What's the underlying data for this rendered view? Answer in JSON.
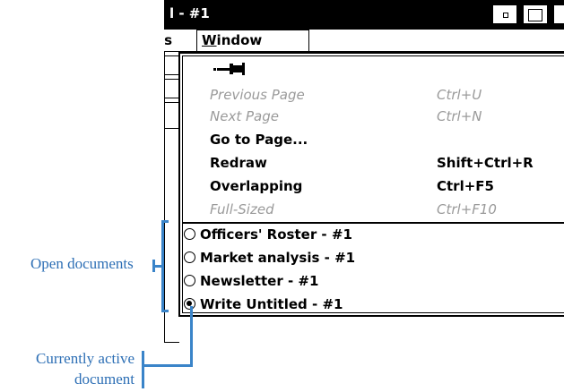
{
  "window": {
    "title": "l - #1",
    "menubar": {
      "cut_label": "es",
      "window_menu": {
        "accel": "W",
        "rest": "indow"
      }
    }
  },
  "menu": {
    "items": [
      {
        "label": "Previous Page",
        "shortcut": "Ctrl+U",
        "disabled": true
      },
      {
        "label": "Next Page",
        "shortcut": "Ctrl+N",
        "disabled": true
      },
      {
        "label": "Go to Page...",
        "shortcut": "",
        "disabled": false
      },
      {
        "label": "Redraw",
        "shortcut": "Shift+Ctrl+R",
        "disabled": false
      },
      {
        "label": "Overlapping",
        "shortcut": "Ctrl+F5",
        "disabled": false
      },
      {
        "label": "Full-Sized",
        "shortcut": "Ctrl+F10",
        "disabled": true
      }
    ],
    "documents": [
      {
        "label": "Officers' Roster - #1",
        "active": false
      },
      {
        "label": "Market analysis - #1",
        "active": false
      },
      {
        "label": "Newsletter - #1",
        "active": false
      },
      {
        "label": "Write Untitled - #1",
        "active": true
      }
    ],
    "pin_icon": "pushpin-icon"
  },
  "annotations": {
    "open_documents": "Open documents",
    "currently_active_line1": "Currently active",
    "currently_active_line2": "document"
  },
  "colors": {
    "annotation": "#2d6fb5",
    "disabled_text": "#9a9a9a"
  }
}
